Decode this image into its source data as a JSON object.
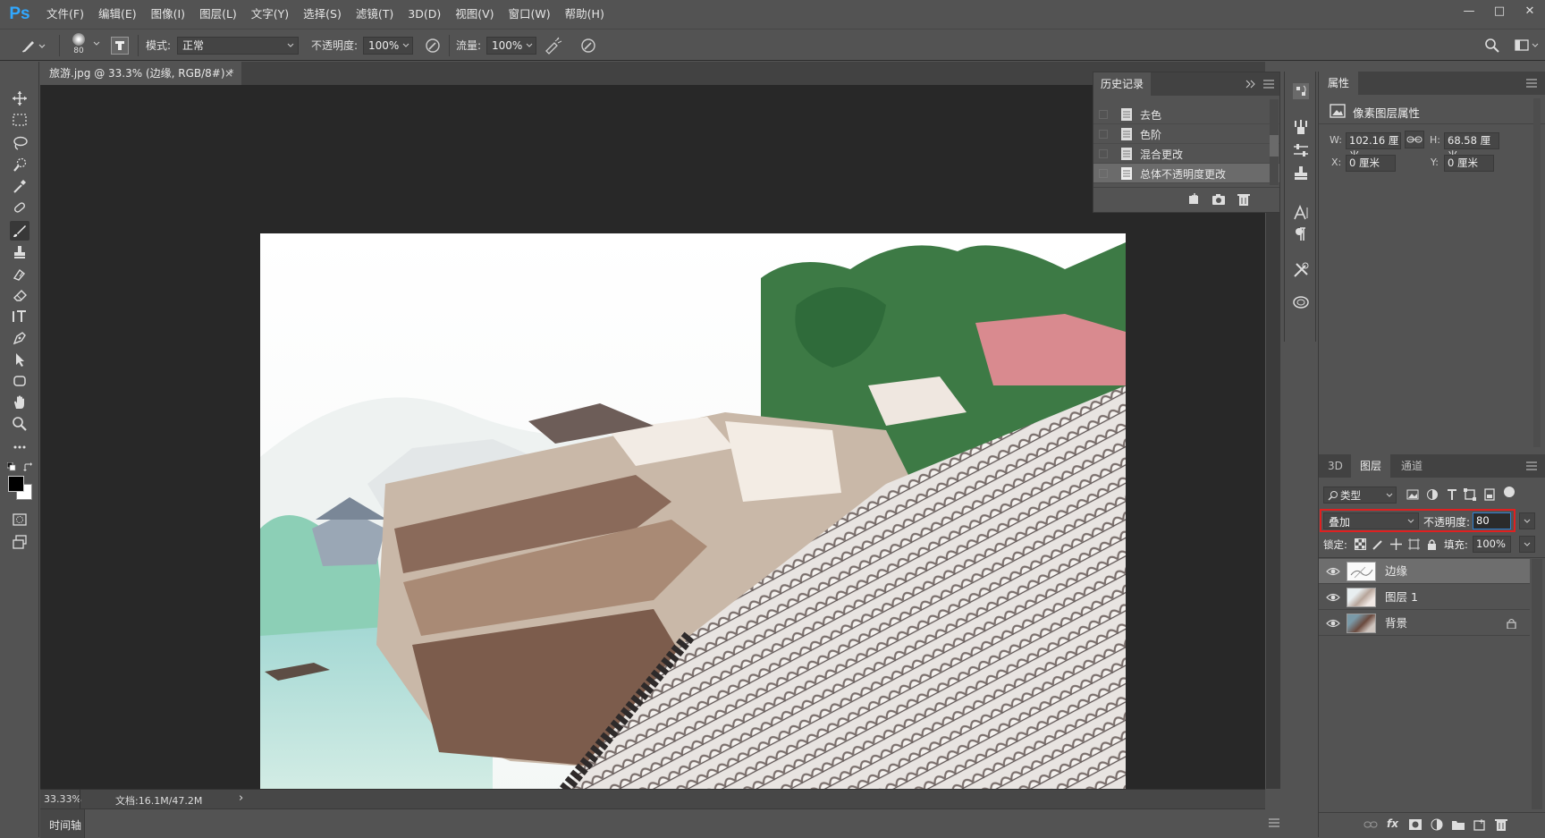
{
  "app": {
    "logo": "Ps"
  },
  "menu": [
    "文件(F)",
    "编辑(E)",
    "图像(I)",
    "图层(L)",
    "文字(Y)",
    "选择(S)",
    "滤镜(T)",
    "3D(D)",
    "视图(V)",
    "窗口(W)",
    "帮助(H)"
  ],
  "window_controls": {
    "minimize": "—",
    "maximize": "□",
    "close": "✕"
  },
  "options": {
    "brush_size": "80",
    "mode_label": "模式:",
    "mode_value": "正常",
    "opacity_label": "不透明度:",
    "opacity_value": "100%",
    "flow_label": "流量:",
    "flow_value": "100%"
  },
  "document": {
    "tab_title": "旅游.jpg @ 33.3% (边缘, RGB/8#) *",
    "close_glyph": "×",
    "zoom": "33.33%",
    "doc_size": "文档:16.1M/47.2M",
    "status_arrow": "›"
  },
  "timeline": {
    "label": "时间轴"
  },
  "history": {
    "title": "历史记录",
    "items": [
      "去色",
      "色阶",
      "混合更改",
      "总体不透明度更改"
    ],
    "selected_index": 3
  },
  "properties": {
    "title": "属性",
    "subtitle": "像素图层属性",
    "w_label": "W:",
    "w_value": "102.16 厘米",
    "h_label": "H:",
    "h_value": "68.58 厘米",
    "x_label": "X:",
    "x_value": "0 厘米",
    "y_label": "Y:",
    "y_value": "0 厘米"
  },
  "layers_panel": {
    "tabs": [
      "3D",
      "图层",
      "通道"
    ],
    "active_tab": "图层",
    "filter_label": "类型",
    "blend_mode": "叠加",
    "opacity_label": "不透明度:",
    "opacity_value": "80",
    "lock_label": "锁定:",
    "fill_label": "填充:",
    "fill_value": "100%",
    "layers": [
      {
        "name": "边缘",
        "selected": true,
        "locked": false
      },
      {
        "name": "图层 1",
        "selected": false,
        "locked": false
      },
      {
        "name": "背景",
        "selected": false,
        "locked": true
      }
    ]
  },
  "colors": {
    "ps_blue": "#31a8ff",
    "panel_bg": "#535353",
    "canvas_bg": "#282828",
    "highlight_red": "#e02020",
    "selection": "#6e6e6e"
  }
}
